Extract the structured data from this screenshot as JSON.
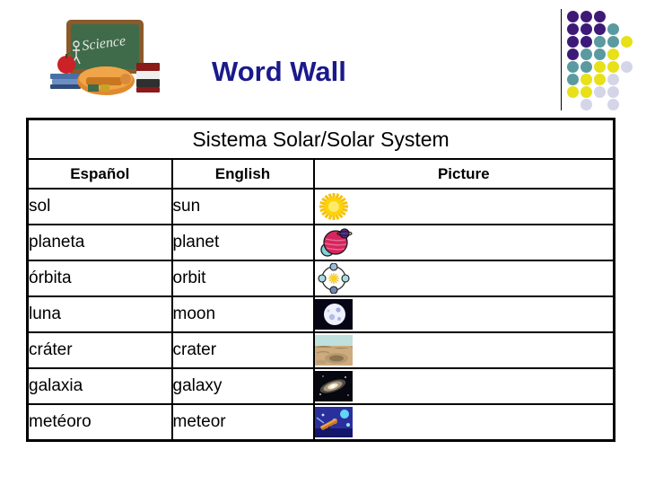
{
  "header": {
    "title": "Word Wall",
    "title_color": "#1a1a8c",
    "clipart_name": "science-chalkboard-clipart",
    "chalkboard_text": "Science"
  },
  "dot_grid": {
    "colors": {
      "purple": "#3d1a78",
      "teal": "#5a9aa0",
      "yellow": "#e8e019",
      "lavender": "#d5d5e8"
    },
    "rows": [
      [
        "purple",
        "purple",
        "purple",
        null,
        null
      ],
      [
        "purple",
        "purple",
        "purple",
        "teal",
        null
      ],
      [
        "purple",
        "purple",
        "teal",
        "teal",
        "yellow"
      ],
      [
        "purple",
        "teal",
        "teal",
        "yellow",
        null
      ],
      [
        "teal",
        "teal",
        "yellow",
        "yellow",
        "lavender"
      ],
      [
        "teal",
        "yellow",
        "yellow",
        "lavender",
        null
      ],
      [
        "yellow",
        "yellow",
        "lavender",
        "lavender",
        null
      ],
      [
        null,
        "lavender",
        null,
        "lavender",
        null
      ]
    ]
  },
  "table": {
    "topic_title": "Sistema Solar/Solar System",
    "columns": [
      "Español",
      "English",
      "Picture"
    ],
    "rows": [
      {
        "spanish": "sol",
        "english": "sun",
        "picture": "sun-icon"
      },
      {
        "spanish": "planeta",
        "english": "planet",
        "picture": "planet-icon"
      },
      {
        "spanish": "órbita",
        "english": "orbit",
        "picture": "orbit-icon"
      },
      {
        "spanish": "luna",
        "english": "moon",
        "picture": "moon-icon"
      },
      {
        "spanish": "cráter",
        "english": "crater",
        "picture": "crater-icon"
      },
      {
        "spanish": "galaxia",
        "english": "galaxy",
        "picture": "galaxy-icon"
      },
      {
        "spanish": "metéoro",
        "english": "meteor",
        "picture": "meteor-icon"
      }
    ]
  }
}
